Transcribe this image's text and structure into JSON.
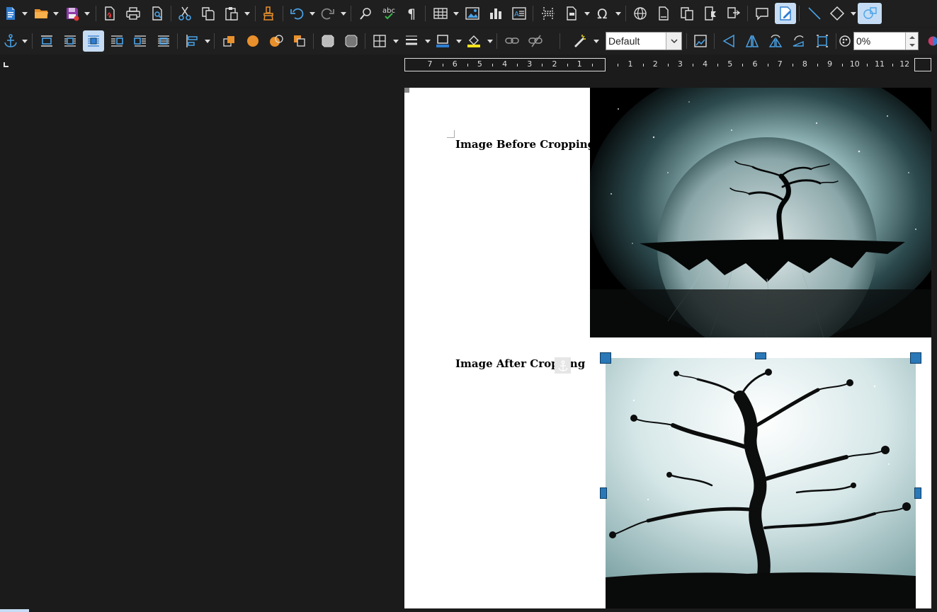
{
  "toolbar_main": {
    "items": [
      {
        "name": "new-document-icon",
        "tooltip": ""
      },
      {
        "name": "open-folder-icon"
      },
      {
        "name": "save-icon"
      },
      {
        "name": "export-pdf-icon"
      },
      {
        "name": "print-icon"
      },
      {
        "name": "print-preview-icon"
      },
      {
        "name": "cut-icon"
      },
      {
        "name": "copy-icon"
      },
      {
        "name": "paste-icon"
      },
      {
        "name": "clone-formatting-icon"
      },
      {
        "name": "undo-icon"
      },
      {
        "name": "redo-icon"
      },
      {
        "name": "find-replace-icon"
      },
      {
        "name": "spelling-icon",
        "label": "abc"
      },
      {
        "name": "formatting-marks-icon",
        "label": "¶"
      },
      {
        "name": "insert-table-icon"
      },
      {
        "name": "insert-image-icon"
      },
      {
        "name": "insert-chart-icon"
      },
      {
        "name": "insert-textbox-icon"
      },
      {
        "name": "insert-page-break-icon"
      },
      {
        "name": "insert-field-icon"
      },
      {
        "name": "special-character-icon",
        "label": "Ω"
      },
      {
        "name": "insert-hyperlink-icon"
      },
      {
        "name": "insert-footnote-icon"
      },
      {
        "name": "insert-endnote-icon"
      },
      {
        "name": "insert-bookmark-icon"
      },
      {
        "name": "insert-cross-reference-icon"
      },
      {
        "name": "insert-comment-icon"
      },
      {
        "name": "track-changes-icon"
      },
      {
        "name": "insert-line-icon"
      },
      {
        "name": "basic-shapes-icon"
      },
      {
        "name": "show-draw-functions-icon"
      }
    ]
  },
  "toolbar_frame": {
    "anchor_label": "⚓",
    "style_combo_value": "Default",
    "transparency_value": "0%"
  },
  "ruler": {
    "left_numbers": [
      "7",
      "6",
      "5",
      "4",
      "3",
      "2",
      "1"
    ],
    "right_numbers": [
      "1",
      "2",
      "3",
      "4",
      "5",
      "6",
      "7",
      "8",
      "9",
      "10",
      "11",
      "12"
    ]
  },
  "document": {
    "caption_before": "Image Before Cropping",
    "caption_after": "Image After Cropping"
  },
  "colors": {
    "accent_active": "#c6dcf4",
    "handle": "#2a78b8",
    "workspace": "#1b1b1b"
  }
}
